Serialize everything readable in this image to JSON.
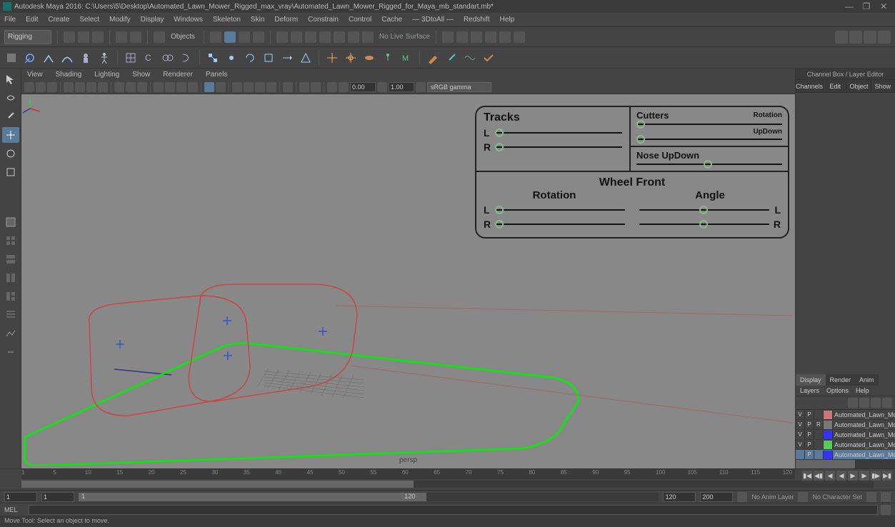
{
  "titlebar": {
    "text": "Autodesk Maya 2016: C:\\Users\\5\\Desktop\\Automated_Lawn_Mower_Rigged_max_vray\\Automated_Lawn_Mower_Rigged_for_Maya_mb_standart.mb*"
  },
  "mainmenu": {
    "items": [
      "File",
      "Edit",
      "Create",
      "Select",
      "Modify",
      "Display",
      "Windows",
      "Skeleton",
      "Skin",
      "Deform",
      "Constrain",
      "Control",
      "Cache",
      "—  3DtoAll  —",
      "Redshift",
      "Help"
    ]
  },
  "statusline": {
    "mode": "Rigging",
    "objects_label": "Objects",
    "nolive": "No Live Surface"
  },
  "vp_menu": {
    "items": [
      "View",
      "Shading",
      "Lighting",
      "Show",
      "Renderer",
      "Panels"
    ]
  },
  "vp_toolbar": {
    "field1": "0.00",
    "field2": "1.00",
    "gamma": "sRGB gamma"
  },
  "persp": "persp",
  "hud": {
    "tracks": "Tracks",
    "cutters": "Cutters",
    "rotation_sm": "Rotation",
    "updown": "UpDown",
    "nose": "Nose UpDown",
    "wheel": "Wheel Front",
    "rotation": "Rotation",
    "angle": "Angle",
    "L": "L",
    "R": "R"
  },
  "rightpanel": {
    "header": "Channel Box / Layer Editor",
    "tabs": [
      "Channels",
      "Edit",
      "Object",
      "Show"
    ],
    "disptabs": [
      "Display",
      "Render",
      "Anim"
    ],
    "layermenu": [
      "Layers",
      "Options",
      "Help"
    ],
    "layers": [
      {
        "v": "V",
        "p": "P",
        "r": "",
        "color": "#c77",
        "name": "Automated_Lawn_Mov"
      },
      {
        "v": "V",
        "p": "P",
        "r": "R",
        "color": "#777",
        "name": "Automated_Lawn_Mower"
      },
      {
        "v": "V",
        "p": "P",
        "r": "",
        "color": "#33f",
        "name": "Automated_Lawn_Mov"
      },
      {
        "v": "V",
        "p": "P",
        "r": "",
        "color": "#5c5",
        "name": "Automated_Lawn_Mov"
      },
      {
        "v": "",
        "p": "P",
        "r": "",
        "color": "#33f",
        "name": "Automated_Lawn_Mov"
      }
    ]
  },
  "timeline": {
    "ticks": [
      "1",
      "5",
      "10",
      "15",
      "20",
      "25",
      "30",
      "35",
      "40",
      "45",
      "50",
      "55",
      "60",
      "65",
      "70",
      "75",
      "80",
      "85",
      "90",
      "95",
      "100",
      "105",
      "110",
      "115",
      "120"
    ],
    "range_start": "1",
    "range_end": "1"
  },
  "rangeline": {
    "f1": "1",
    "f2": "1",
    "f3": "120",
    "f4": "120",
    "f5": "200",
    "noanim": "No Anim Layer",
    "nochar": "No Character Set"
  },
  "cmdline": {
    "label": "MEL"
  },
  "helpline": {
    "text": "Move Tool: Select an object to move."
  }
}
